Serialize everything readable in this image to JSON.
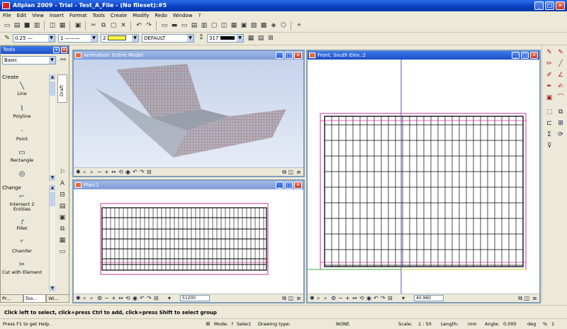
{
  "app": {
    "title": "Allplan 2009 - Trial - Test_A_File - (No fileset):#5"
  },
  "window_buttons": {
    "minimize": "_",
    "maximize": "□",
    "close": "✕"
  },
  "menu": [
    "File",
    "Edit",
    "View",
    "Insert",
    "Format",
    "Tools",
    "Create",
    "Modify",
    "Redo",
    "Window",
    "?"
  ],
  "format_bar": {
    "pen": "0.25",
    "line": "1",
    "color_num": "2",
    "layer": "DEFAULT",
    "pattern_num": "317"
  },
  "tools_palette": {
    "title": "Tools",
    "module": "Basic",
    "side_tab": "Draft",
    "create_heading": "Create",
    "create_tools": [
      "Line",
      "Polyline",
      "Point",
      "Rectangle"
    ],
    "change_heading": "Change",
    "change_tools": [
      "Intersect 2 Entities",
      "Fillet",
      "Chamfer",
      "Cut with Element"
    ],
    "tabs": [
      "Pr...",
      "Too...",
      "Wi..."
    ]
  },
  "viewports": {
    "animation": {
      "title": "Animation: Entire Model"
    },
    "plan": {
      "title": "Plan:1",
      "scale_value": "51200"
    },
    "front": {
      "title": "Front, South Elev.:2",
      "scale_value": "40.960"
    }
  },
  "message": "Click left to select, click+press Ctrl to add, click+press Shift to select group",
  "status": {
    "help": "Press F1 to get Help.",
    "mode_label": "Mode:",
    "mode_value": "Select",
    "drawing_type_label": "Drawing type:",
    "drawing_type_value": "NONE",
    "scale_label": "Scale:",
    "scale_value": "1 : 50",
    "length_label": "Length:",
    "length_unit": "mm",
    "angle_label": "Angle:",
    "angle_value": "0.000",
    "angle_unit": "deg",
    "percent_label": "%",
    "percent_value": "1"
  },
  "colors": {
    "accent": "#0a3fc0",
    "grid_line": "#000000",
    "frame_line": "#cc3399",
    "mesh": "#c04848"
  }
}
